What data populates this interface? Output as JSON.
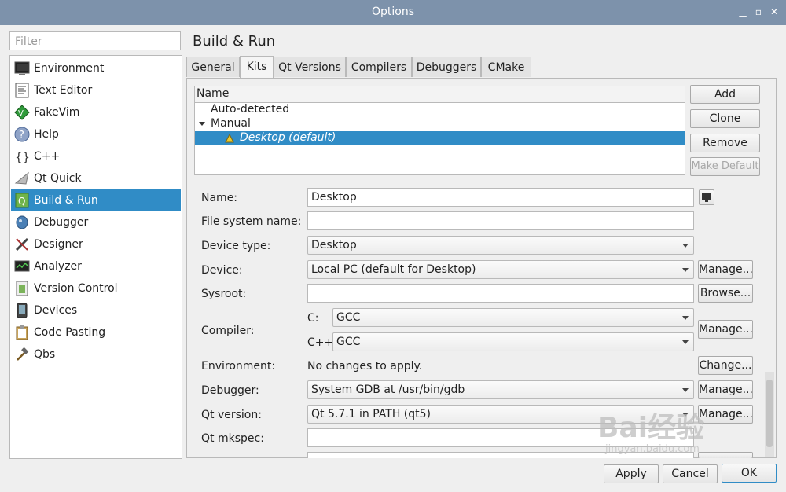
{
  "window": {
    "title": "Options"
  },
  "filter": {
    "placeholder": "Filter"
  },
  "categories": [
    {
      "label": "Environment",
      "icon": "environment-icon"
    },
    {
      "label": "Text Editor",
      "icon": "text-editor-icon"
    },
    {
      "label": "FakeVim",
      "icon": "fakevim-icon"
    },
    {
      "label": "Help",
      "icon": "help-icon"
    },
    {
      "label": "C++",
      "icon": "cpp-icon"
    },
    {
      "label": "Qt Quick",
      "icon": "qt-quick-icon"
    },
    {
      "label": "Build & Run",
      "icon": "build-run-icon",
      "selected": true
    },
    {
      "label": "Debugger",
      "icon": "debugger-icon"
    },
    {
      "label": "Designer",
      "icon": "designer-icon"
    },
    {
      "label": "Analyzer",
      "icon": "analyzer-icon"
    },
    {
      "label": "Version Control",
      "icon": "version-control-icon"
    },
    {
      "label": "Devices",
      "icon": "devices-icon"
    },
    {
      "label": "Code Pasting",
      "icon": "code-pasting-icon"
    },
    {
      "label": "Qbs",
      "icon": "qbs-icon"
    }
  ],
  "page": {
    "title": "Build & Run"
  },
  "tabs": [
    "General",
    "Kits",
    "Qt Versions",
    "Compilers",
    "Debuggers",
    "CMake"
  ],
  "active_tab": "Kits",
  "kits": {
    "header": "Name",
    "auto_detected": "Auto-detected",
    "manual": "Manual",
    "selected_kit": "Desktop (default)"
  },
  "kit_buttons": {
    "add": "Add",
    "clone": "Clone",
    "remove": "Remove",
    "make_default": "Make Default"
  },
  "form": {
    "name_label": "Name:",
    "name_value": "Desktop",
    "fs_label": "File system name:",
    "fs_value": "",
    "device_type_label": "Device type:",
    "device_type_value": "Desktop",
    "device_label": "Device:",
    "device_value": "Local PC (default for Desktop)",
    "sysroot_label": "Sysroot:",
    "sysroot_value": "",
    "compiler_label": "Compiler:",
    "c_label": "C:",
    "c_value": "GCC",
    "cpp_label": "C++:",
    "cpp_value": "GCC",
    "env_label": "Environment:",
    "env_value": "No changes to apply.",
    "debugger_label": "Debugger:",
    "debugger_value": "System GDB at /usr/bin/gdb",
    "qt_version_label": "Qt version:",
    "qt_version_value": "Qt 5.7.1 in PATH (qt5)",
    "mkspec_label": "Qt mkspec:",
    "mkspec_value": "",
    "manage": "Manage...",
    "browse": "Browse...",
    "change": "Change..."
  },
  "dialog_buttons": {
    "apply": "Apply",
    "cancel": "Cancel",
    "ok": "OK"
  },
  "watermark": {
    "text": "Bai经验",
    "sub": "jingyan.baidu.com"
  },
  "colors": {
    "titlebar": "#7d92ab",
    "selection": "#308cc6",
    "warning": "#e8c830"
  }
}
